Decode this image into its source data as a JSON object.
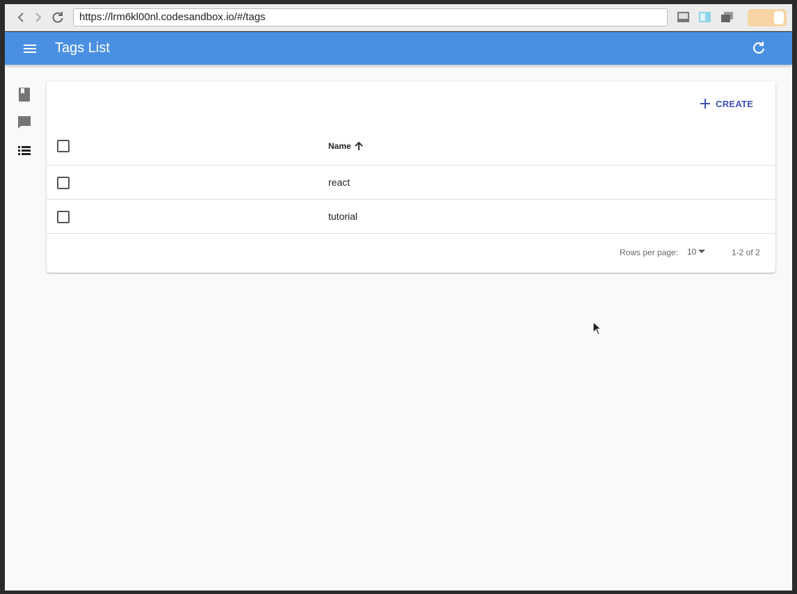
{
  "browser": {
    "url": "https://lrm6kl00nl.codesandbox.io/#/tags"
  },
  "app_bar": {
    "title": "Tags List"
  },
  "sidebar": {
    "items": [
      {
        "icon": "book-icon"
      },
      {
        "icon": "comment-icon"
      },
      {
        "icon": "list-icon"
      }
    ]
  },
  "toolbar": {
    "create_label": "CREATE"
  },
  "table": {
    "header": {
      "name": "Name"
    },
    "rows": [
      {
        "name": "react"
      },
      {
        "name": "tutorial"
      }
    ]
  },
  "pagination": {
    "rows_per_page_label": "Rows per page:",
    "rows_per_page_value": "10",
    "range": "1-2 of 2"
  },
  "colors": {
    "app_bar": "#4a90e2",
    "accent": "#3f51b5",
    "background": "#f9f9f9"
  }
}
